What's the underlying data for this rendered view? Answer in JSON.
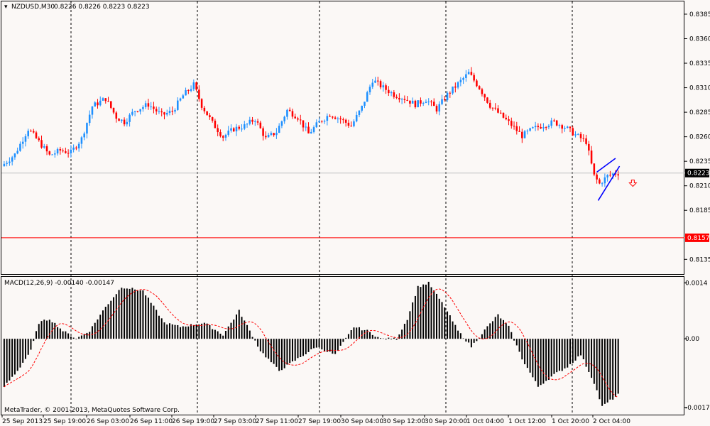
{
  "header": {
    "symbol_timeframe": "NZDUSD,M30",
    "ohlc": "0.8226 0.8226 0.8223 0.8223"
  },
  "price_axis": {
    "ticks": [
      "0.8385",
      "0.8360",
      "0.8335",
      "0.8310",
      "0.8285",
      "0.8260",
      "0.8235",
      "0.8210",
      "0.8185",
      "0.8135"
    ],
    "current_price_label": "0.8223",
    "red_line_label": "0.8157"
  },
  "macd": {
    "label": "MACD(12,26,9) -0.00140 -0.00147",
    "axis_ticks": [
      "0.0014",
      "0.00",
      "-0.00172"
    ]
  },
  "copyright": "MetaTrader, © 2001-2013, MetaQuotes Software Corp.",
  "time_axis": {
    "labels": [
      "25 Sep 2013",
      "25 Sep 19:00",
      "26 Sep 03:00",
      "26 Sep 11:00",
      "26 Sep 19:00",
      "27 Sep 03:00",
      "27 Sep 11:00",
      "27 Sep 19:00",
      "30 Sep 04:00",
      "30 Sep 12:00",
      "30 Sep 20:00",
      "1 Oct 04:00",
      "1 Oct 12:00",
      "1 Oct 20:00",
      "2 Oct 04:00"
    ]
  },
  "colors": {
    "background": "#fbf8f6",
    "bull": "#1e90ff",
    "bear": "#ff0000",
    "pattern_lines": "#0000ff",
    "macd_histogram": "#000000",
    "macd_signal": "#ff0000",
    "current_price_line": "#c0c0c0",
    "red_level_line": "#ff0000",
    "grid": "#000000"
  },
  "chart_data": [
    {
      "type": "candlestick",
      "title": "NZDUSD,M30",
      "y_ticks": [
        0.8385,
        0.836,
        0.8335,
        0.831,
        0.8285,
        0.826,
        0.8235,
        0.821,
        0.8185,
        0.8135
      ],
      "ylim": [
        0.812,
        0.8398
      ],
      "current_price": 0.8223,
      "horizontal_level": 0.8157,
      "close_path": [
        [
          0,
          0.823
        ],
        [
          5,
          0.8242
        ],
        [
          10,
          0.8268
        ],
        [
          14,
          0.8255
        ],
        [
          18,
          0.8241
        ],
        [
          22,
          0.8246
        ],
        [
          26,
          0.8244
        ],
        [
          30,
          0.8258
        ],
        [
          34,
          0.8291
        ],
        [
          39,
          0.8299
        ],
        [
          43,
          0.828
        ],
        [
          46,
          0.8275
        ],
        [
          50,
          0.8287
        ],
        [
          55,
          0.8293
        ],
        [
          60,
          0.8282
        ],
        [
          64,
          0.8286
        ],
        [
          68,
          0.8302
        ],
        [
          72,
          0.8313
        ],
        [
          75,
          0.8292
        ],
        [
          79,
          0.8274
        ],
        [
          83,
          0.826
        ],
        [
          87,
          0.8268
        ],
        [
          91,
          0.8271
        ],
        [
          95,
          0.8278
        ],
        [
          99,
          0.8258
        ],
        [
          103,
          0.8265
        ],
        [
          107,
          0.8287
        ],
        [
          111,
          0.828
        ],
        [
          115,
          0.8263
        ],
        [
          119,
          0.8275
        ],
        [
          123,
          0.8283
        ],
        [
          127,
          0.8278
        ],
        [
          131,
          0.8271
        ],
        [
          135,
          0.829
        ],
        [
          139,
          0.8318
        ],
        [
          143,
          0.831
        ],
        [
          147,
          0.8303
        ],
        [
          151,
          0.8299
        ],
        [
          155,
          0.8293
        ],
        [
          159,
          0.8298
        ],
        [
          163,
          0.8288
        ],
        [
          167,
          0.8303
        ],
        [
          171,
          0.8314
        ],
        [
          175,
          0.8325
        ],
        [
          179,
          0.831
        ],
        [
          183,
          0.8292
        ],
        [
          187,
          0.8282
        ],
        [
          191,
          0.8272
        ],
        [
          195,
          0.8261
        ],
        [
          199,
          0.8268
        ],
        [
          203,
          0.8272
        ],
        [
          207,
          0.8275
        ],
        [
          211,
          0.827
        ],
        [
          215,
          0.8262
        ],
        [
          219,
          0.8255
        ],
        [
          222,
          0.822
        ],
        [
          224,
          0.8212
        ],
        [
          227,
          0.822
        ],
        [
          230,
          0.8223
        ]
      ],
      "pattern": {
        "upper_start": [
          222.5,
          0.8224
        ],
        "upper_end": [
          229.5,
          0.8238
        ],
        "lower_start": [
          223,
          0.8195
        ],
        "lower_end": [
          231,
          0.823
        ]
      },
      "down_arrow_position": [
        236,
        0.8213
      ]
    },
    {
      "type": "macd",
      "title": "MACD(12,26,9) -0.00140 -0.00147",
      "params": [
        12,
        26,
        9
      ],
      "y_ticks": [
        0.0014,
        0.0,
        -0.00172
      ],
      "ylim": [
        -0.0019,
        0.00155
      ],
      "histogram_path": [
        [
          0,
          -0.0012
        ],
        [
          5,
          -0.0008
        ],
        [
          10,
          -0.0003
        ],
        [
          13,
          0.0004
        ],
        [
          17,
          0.0005
        ],
        [
          22,
          0.0002
        ],
        [
          27,
          0.0
        ],
        [
          32,
          0.0002
        ],
        [
          38,
          0.0008
        ],
        [
          44,
          0.0013
        ],
        [
          52,
          0.0012
        ],
        [
          60,
          0.0004
        ],
        [
          66,
          0.0003
        ],
        [
          75,
          0.0004
        ],
        [
          82,
          0.0001
        ],
        [
          88,
          0.0007
        ],
        [
          92,
          0.0002
        ],
        [
          96,
          -0.0003
        ],
        [
          103,
          -0.0008
        ],
        [
          110,
          -0.0005
        ],
        [
          117,
          -0.0002
        ],
        [
          124,
          -0.0004
        ],
        [
          131,
          0.0003
        ],
        [
          136,
          0.0002
        ],
        [
          141,
          0.0
        ],
        [
          147,
          0.0
        ],
        [
          151,
          0.0005
        ],
        [
          155,
          0.0013
        ],
        [
          159,
          0.0014
        ],
        [
          165,
          0.0008
        ],
        [
          170,
          0.0002
        ],
        [
          175,
          -0.0002
        ],
        [
          181,
          0.0003
        ],
        [
          185,
          0.0006
        ],
        [
          189,
          0.0003
        ],
        [
          194,
          -0.0005
        ],
        [
          200,
          -0.0012
        ],
        [
          206,
          -0.0009
        ],
        [
          211,
          -0.0007
        ],
        [
          216,
          -0.0004
        ],
        [
          221,
          -0.0011
        ],
        [
          224,
          -0.0017
        ],
        [
          228,
          -0.0015
        ],
        [
          230,
          -0.0014
        ]
      ]
    }
  ]
}
